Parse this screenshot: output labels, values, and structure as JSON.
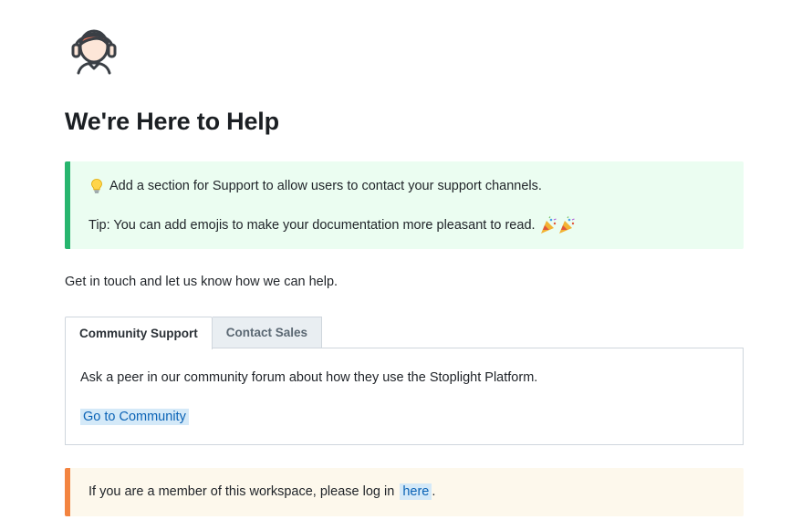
{
  "header": {
    "avatar_icon": "support-agent-headset-icon",
    "title": "We're Here to Help"
  },
  "callout_info": {
    "icon": "lightbulb-icon",
    "line1": "Add a section for Support to allow users to contact your support channels.",
    "line2": "Tip: You can add emojis to make your documentation more pleasant to read.",
    "trailing_icons": "party-popper-icons",
    "accent_color": "#27b56e",
    "background_color": "#ebfdf1"
  },
  "intro_text": "Get in touch and let us know how we can help.",
  "tabs": [
    {
      "label": "Community Support",
      "active": true
    },
    {
      "label": "Contact Sales",
      "active": false
    }
  ],
  "tab_panel": {
    "description": "Ask a peer in our community forum about how they use the Stoplight Platform.",
    "link_label": "Go to Community"
  },
  "callout_login": {
    "text": "If you are a member of this workspace, please log in",
    "link_label": "here",
    "suffix": ".",
    "accent_color": "#f38440",
    "background_color": "#fdf8ec"
  },
  "colors": {
    "link": "#0b63b6",
    "link_highlight": "#d4e9f8",
    "border": "#cfd6dd"
  }
}
